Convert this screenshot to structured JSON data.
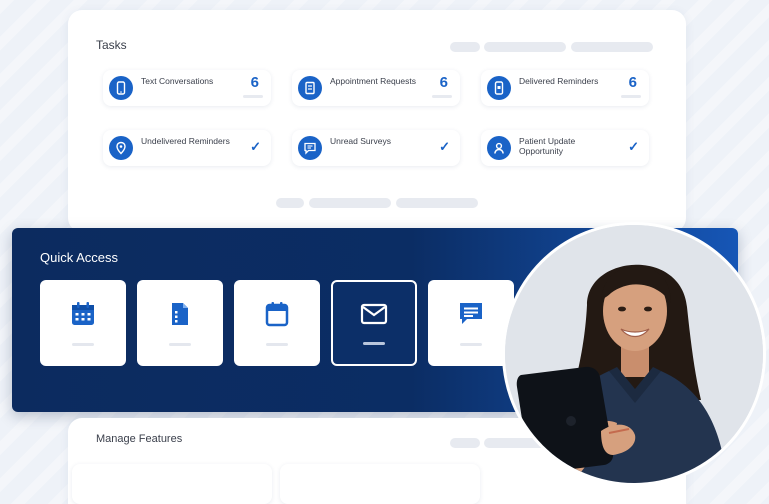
{
  "tasks": {
    "title": "Tasks",
    "items": [
      {
        "label": "Text Conversations",
        "count": "6",
        "status": "count",
        "icon": "phone-icon"
      },
      {
        "label": "Appointment Requests",
        "count": "6",
        "status": "count",
        "icon": "document-icon"
      },
      {
        "label": "Delivered Reminders",
        "count": "6",
        "status": "count",
        "icon": "mobile-notification-icon"
      },
      {
        "label": "Undelivered Reminders",
        "check": "✓",
        "status": "check",
        "icon": "location-pin-icon"
      },
      {
        "label": "Unread Surveys",
        "check": "✓",
        "status": "check",
        "icon": "chat-icon"
      },
      {
        "label": "Patient Update Opportunity",
        "check": "✓",
        "status": "check",
        "icon": "user-icon"
      }
    ]
  },
  "quick_access": {
    "title": "Quick Access",
    "tiles": [
      {
        "icon": "calendar-grid-icon",
        "active": false
      },
      {
        "icon": "document-list-icon",
        "active": false
      },
      {
        "icon": "calendar-icon",
        "active": false
      },
      {
        "icon": "mail-icon",
        "active": true
      },
      {
        "icon": "message-icon",
        "active": false
      }
    ]
  },
  "manage_features": {
    "title": "Manage Features"
  },
  "colors": {
    "accent": "#1a63c7",
    "navy": "#0c2b5f",
    "panel": "#ffffff"
  }
}
